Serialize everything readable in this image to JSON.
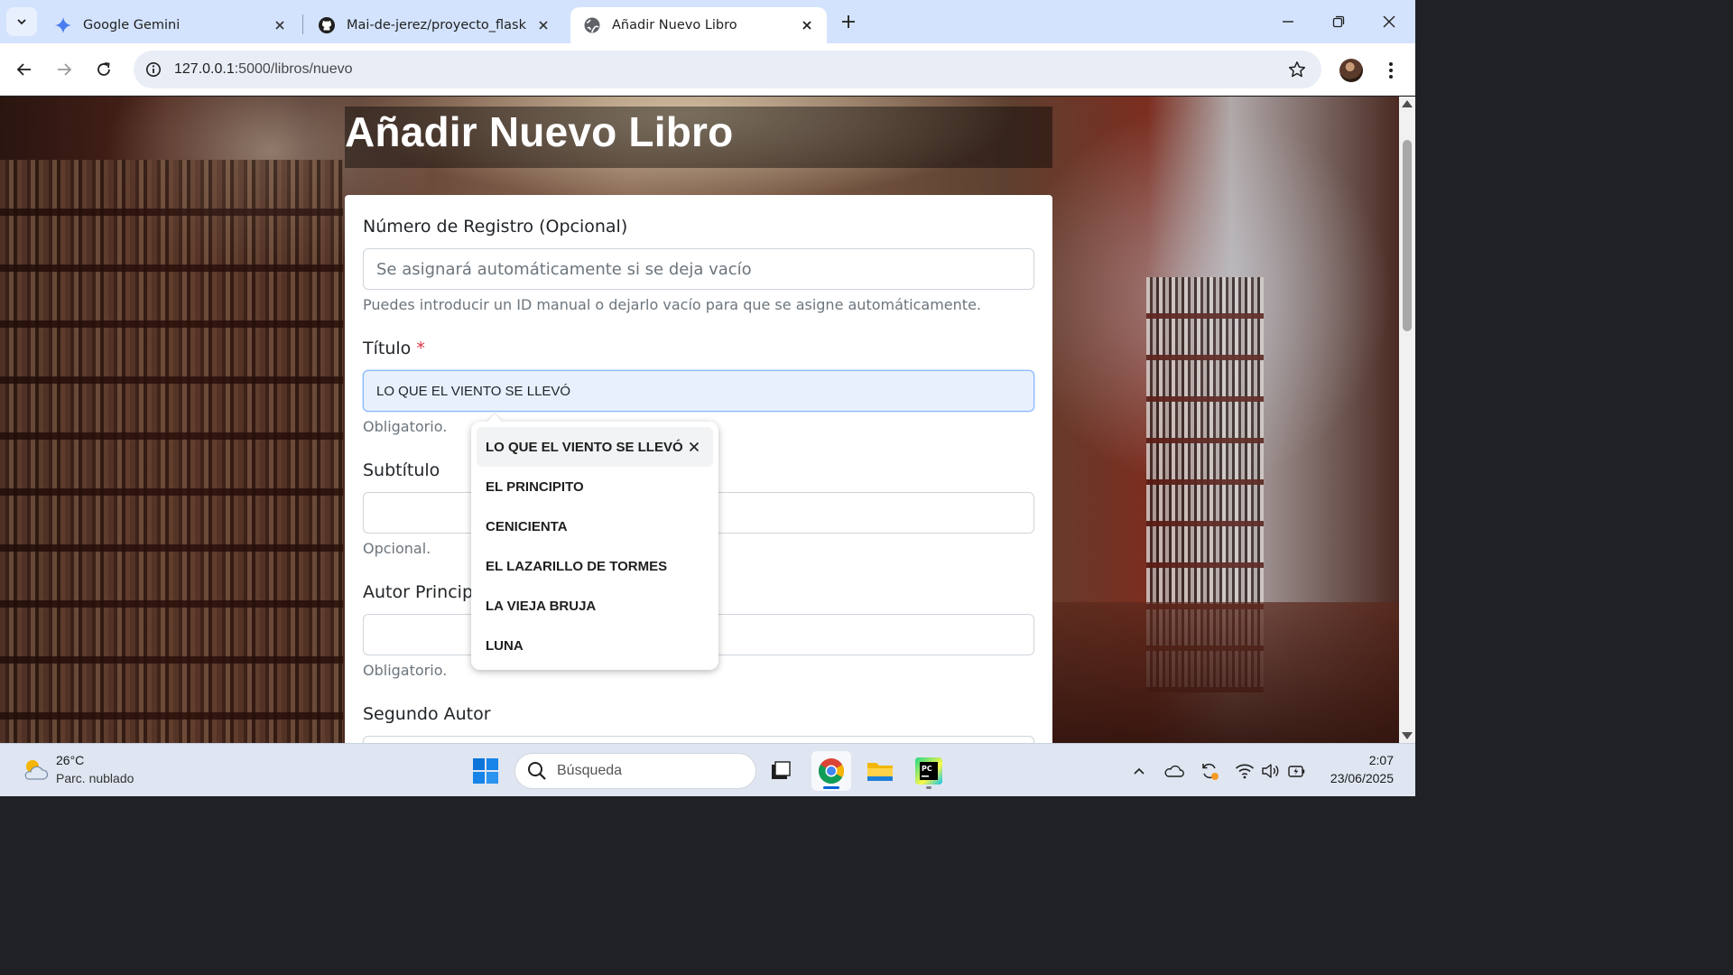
{
  "browser": {
    "tabs": [
      {
        "title": "Google Gemini",
        "icon": "gemini-icon"
      },
      {
        "title": "Mai-de-jerez/proyecto_flask",
        "icon": "github-icon"
      },
      {
        "title": "Añadir Nuevo Libro",
        "icon": "globe-icon",
        "active": true
      }
    ],
    "url_host": "127.0.0.1",
    "url_rest": ":5000/libros/nuevo"
  },
  "page": {
    "title": "Añadir Nuevo Libro",
    "form": {
      "registro": {
        "label": "Número de Registro (Opcional)",
        "placeholder": "Se asignará automáticamente si se deja vacío",
        "help": "Puedes introducir un ID manual o dejarlo vacío para que se asigne automáticamente."
      },
      "titulo": {
        "label": "Título",
        "required_mark": "*",
        "value": "LO QUE EL VIENTO SE LLEVÓ",
        "help": "Obligatorio."
      },
      "subtitulo": {
        "label": "Subtítulo",
        "value": "",
        "help": "Opcional."
      },
      "autor_principal": {
        "label": "Autor Principal",
        "value": "",
        "help": "Obligatorio."
      },
      "segundo_autor": {
        "label": "Segundo Autor",
        "value": ""
      }
    }
  },
  "autocomplete": {
    "items": [
      "LO QUE EL VIENTO SE LLEVÓ",
      "EL PRINCIPITO",
      "CENICIENTA",
      "EL LAZARILLO DE TORMES",
      "LA VIEJA BRUJA",
      "LUNA"
    ]
  },
  "taskbar": {
    "weather_temp": "26°C",
    "weather_desc": "Parc. nublado",
    "search_label": "Búsqueda",
    "time": "2:07",
    "date": "23/06/2025"
  },
  "colors": {
    "tabstrip": "#d3e3fd",
    "focused_input": "#e8f0fe",
    "required": "#dc3545",
    "taskbar": "#dfe6f1"
  }
}
